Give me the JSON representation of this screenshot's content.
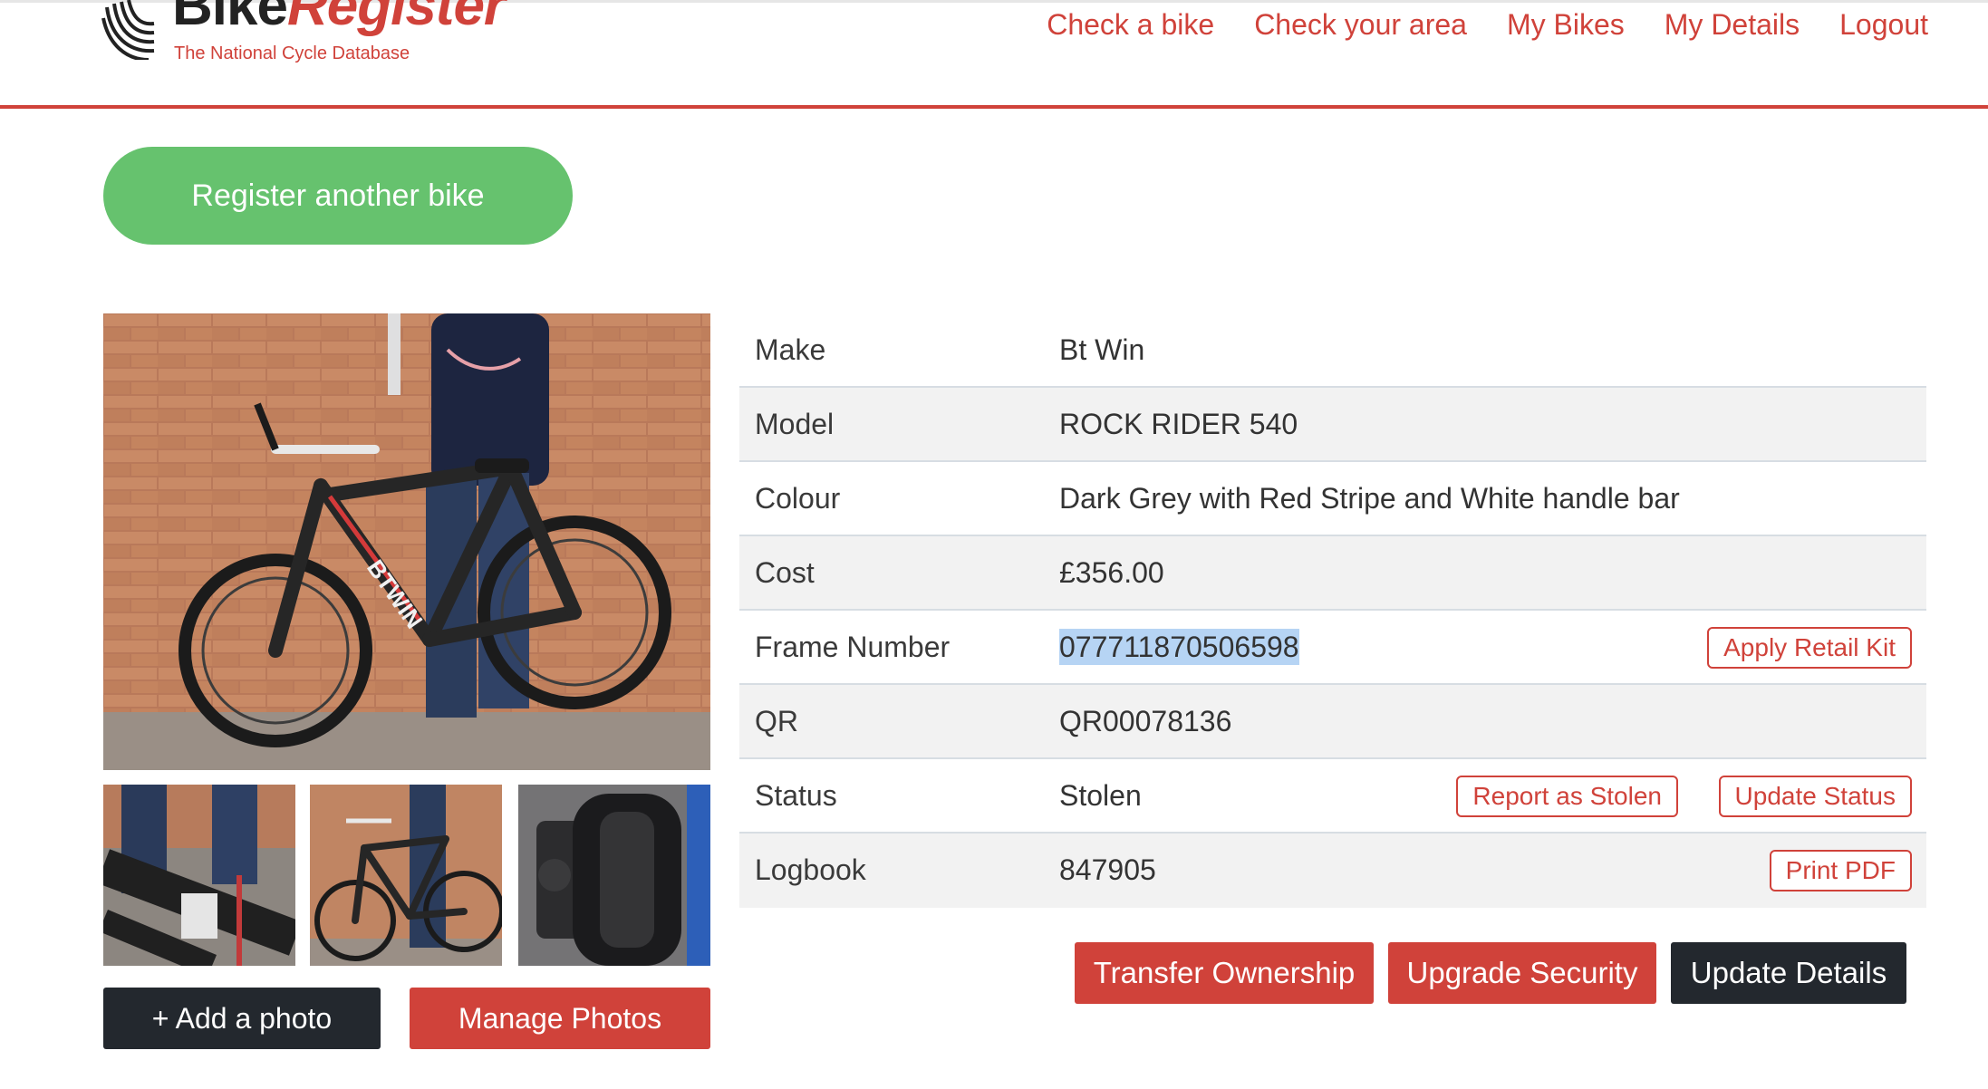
{
  "header": {
    "logo": {
      "word_dark": "Bike",
      "word_red": "Register",
      "tagline": "The National Cycle Database"
    },
    "nav": [
      "Check a bike",
      "Check your area",
      "My Bikes",
      "My Details",
      "Logout"
    ]
  },
  "register_button": "Register another bike",
  "photos": {
    "add_label": "+ Add a photo",
    "manage_label": "Manage Photos",
    "brand_on_frame": "BTWIN"
  },
  "details": {
    "rows": [
      {
        "label": "Make",
        "value": "Bt Win"
      },
      {
        "label": "Model",
        "value": "ROCK RIDER 540"
      },
      {
        "label": "Colour",
        "value": "Dark Grey with Red Stripe and White handle bar"
      },
      {
        "label": "Cost",
        "value": "£356.00"
      },
      {
        "label": "Frame Number",
        "value": "077711870506598",
        "actions": [
          "Apply Retail Kit"
        ]
      },
      {
        "label": "QR",
        "value": "QR00078136"
      },
      {
        "label": "Status",
        "value": "Stolen",
        "actions": [
          "Report as Stolen",
          "Update Status"
        ]
      },
      {
        "label": "Logbook",
        "value": "847905",
        "actions": [
          "Print PDF"
        ]
      }
    ]
  },
  "actions": {
    "transfer": "Transfer Ownership",
    "upgrade": "Upgrade Security",
    "update": "Update Details"
  },
  "colors": {
    "brand_red": "#d0423a",
    "register_green": "#66c26e",
    "dark_button": "#23282e",
    "row_alt": "#f2f2f2",
    "selection": "#b6d4f4"
  }
}
